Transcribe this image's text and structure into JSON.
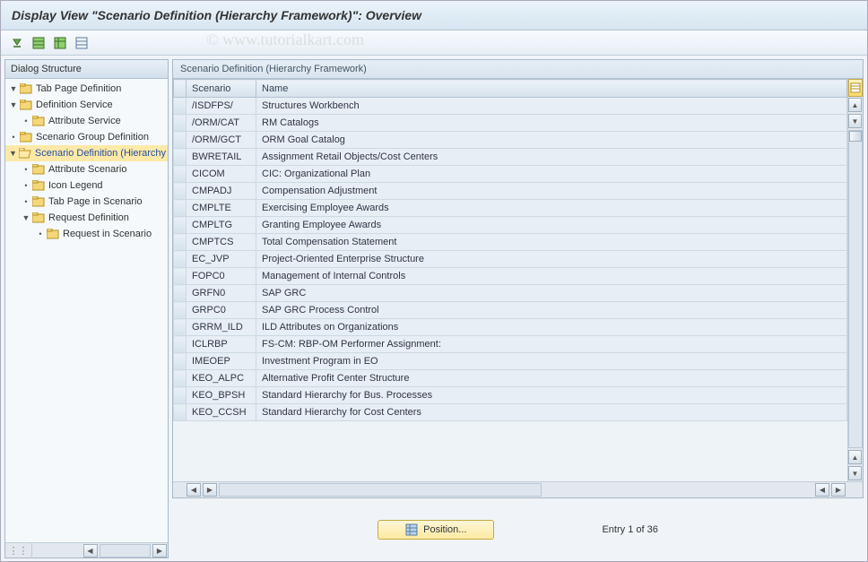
{
  "window_title": "Display View \"Scenario Definition (Hierarchy Framework)\": Overview",
  "watermark": "© www.tutorialkart.com",
  "tree": {
    "header": "Dialog Structure",
    "items": [
      {
        "label": "Tab Page Definition",
        "indent": 0,
        "exp": "▾",
        "open": false
      },
      {
        "label": "Definition Service",
        "indent": 0,
        "exp": "▾",
        "open": false
      },
      {
        "label": "Attribute Service",
        "indent": 1,
        "exp": "•",
        "open": false
      },
      {
        "label": "Scenario Group Definition",
        "indent": 0,
        "exp": "•",
        "open": false
      },
      {
        "label": "Scenario Definition (Hierarchy Framework)",
        "indent": 0,
        "exp": "▾",
        "open": true,
        "selected": true
      },
      {
        "label": "Attribute Scenario",
        "indent": 1,
        "exp": "•",
        "open": false
      },
      {
        "label": "Icon Legend",
        "indent": 1,
        "exp": "•",
        "open": false
      },
      {
        "label": "Tab Page in Scenario",
        "indent": 1,
        "exp": "•",
        "open": false
      },
      {
        "label": "Request Definition",
        "indent": 1,
        "exp": "▾",
        "open": false
      },
      {
        "label": "Request in Scenario",
        "indent": 2,
        "exp": "•",
        "open": false
      }
    ]
  },
  "table": {
    "caption": "Scenario Definition (Hierarchy Framework)",
    "columns": {
      "scenario": "Scenario",
      "name": "Name"
    },
    "rows": [
      {
        "scenario": "/ISDFPS/",
        "name": "Structures Workbench"
      },
      {
        "scenario": "/ORM/CAT",
        "name": "RM Catalogs"
      },
      {
        "scenario": "/ORM/GCT",
        "name": "ORM Goal Catalog"
      },
      {
        "scenario": "BWRETAIL",
        "name": "Assignment Retail Objects/Cost Centers"
      },
      {
        "scenario": "CICOM",
        "name": "CIC: Organizational Plan"
      },
      {
        "scenario": "CMPADJ",
        "name": "Compensation Adjustment"
      },
      {
        "scenario": "CMPLTE",
        "name": "Exercising Employee Awards"
      },
      {
        "scenario": "CMPLTG",
        "name": "Granting Employee Awards"
      },
      {
        "scenario": "CMPTCS",
        "name": "Total Compensation Statement"
      },
      {
        "scenario": "EC_JVP",
        "name": "Project-Oriented Enterprise Structure"
      },
      {
        "scenario": "FOPC0",
        "name": "Management of Internal Controls"
      },
      {
        "scenario": "GRFN0",
        "name": "SAP GRC"
      },
      {
        "scenario": "GRPC0",
        "name": "SAP GRC Process Control"
      },
      {
        "scenario": "GRRM_ILD",
        "name": "ILD Attributes on Organizations"
      },
      {
        "scenario": "ICLRBP",
        "name": "FS-CM: RBP-OM Performer Assignment:"
      },
      {
        "scenario": "IMEOEP",
        "name": "Investment Program in EO"
      },
      {
        "scenario": "KEO_ALPC",
        "name": "Alternative Profit Center Structure"
      },
      {
        "scenario": "KEO_BPSH",
        "name": "Standard Hierarchy for Bus. Processes"
      },
      {
        "scenario": "KEO_CCSH",
        "name": "Standard Hierarchy for Cost Centers"
      }
    ]
  },
  "footer": {
    "position_label": "Position...",
    "entry_status": "Entry 1 of 36"
  }
}
